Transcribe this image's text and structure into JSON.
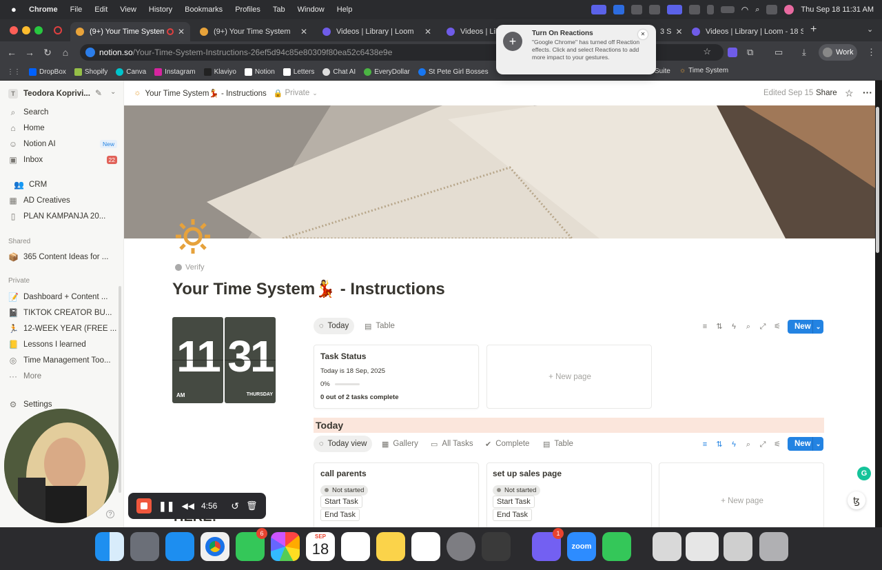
{
  "menubar": {
    "app": "Chrome",
    "items": [
      "File",
      "Edit",
      "View",
      "History",
      "Bookmarks",
      "Profiles",
      "Tab",
      "Window",
      "Help"
    ],
    "clock": "Thu Sep 18  11:31 AM"
  },
  "tabs": [
    {
      "label": "(9+) Your Time System - I",
      "active": true
    },
    {
      "label": "(9+) Your Time System"
    },
    {
      "label": "Videos | Library | Loom"
    },
    {
      "label": "Videos | Librar"
    },
    {
      "label": "Videos | Library | Loom - 18 S"
    }
  ],
  "tab_partial": "3 S",
  "address": {
    "host": "notion.so",
    "path": "/Your-Time-System-Instructions-26ef5d94c85e80309f80ea52c6438e9e"
  },
  "profile": "Work",
  "bookmarks": [
    "DropBox",
    "Shopify",
    "Canva",
    "Instagram",
    "Klaviyo",
    "Notion",
    "Letters",
    "Chat AI",
    "EveryDollar",
    "St Pete Girl Bosses",
    "Suite",
    "Time System"
  ],
  "notification": {
    "title": "Turn On Reactions",
    "body": "\"Google Chrome\" has turned off Reaction effects. Click  and select Reactions to add more impact to your gestures."
  },
  "sidebar": {
    "workspace": "Teodora Koprivi...",
    "top": [
      {
        "label": "Search",
        "icon": "search-icon"
      },
      {
        "label": "Home",
        "icon": "home-icon"
      },
      {
        "label": "Notion AI",
        "icon": "ai-icon",
        "tag": "New"
      },
      {
        "label": "Inbox",
        "icon": "inbox-icon",
        "count": "22"
      }
    ],
    "teamspace": [
      {
        "label": "CRM"
      },
      {
        "label": "AD Creatives"
      },
      {
        "label": "PLAN KAMPANJA 20..."
      }
    ],
    "shared_label": "Shared",
    "shared": [
      {
        "label": "365 Content Ideas for ..."
      }
    ],
    "private_label": "Private",
    "private": [
      {
        "label": "Dashboard + Content ..."
      },
      {
        "label": "TIKTOK CREATOR BU..."
      },
      {
        "label": "12-WEEK YEAR (FREE ..."
      },
      {
        "label": "Lessons I learned"
      },
      {
        "label": "Time Management Too..."
      }
    ],
    "more": "More",
    "settings": "Settings"
  },
  "page": {
    "breadcrumb": "Your Time System💃 - Instructions",
    "privacy": "Private",
    "edited": "Edited Sep 15",
    "share": "Share",
    "verify": "Verify",
    "title": "Your Time System💃 - Instructions",
    "clock": {
      "hour": "11",
      "minute": "31",
      "ampm": "AM",
      "day": "THURSDAY"
    },
    "views1": [
      {
        "label": "Today",
        "selected": true
      },
      {
        "label": "Table"
      }
    ],
    "new_button": "New",
    "task_status": {
      "title": "Task Status",
      "date_line": "Today is 18 Sep, 2025",
      "progress_text": "0%",
      "progress": 0,
      "complete_line": "0 out of 2 tasks complete"
    },
    "new_page": "New page",
    "today_heading": "Today",
    "views2": [
      {
        "label": "Today view",
        "selected": true
      },
      {
        "label": "Gallery"
      },
      {
        "label": "All Tasks"
      },
      {
        "label": "Complete"
      },
      {
        "label": "Table"
      }
    ],
    "cards": [
      {
        "title": "call parents",
        "status": "Not started",
        "start": "Start Task",
        "end": "End Task"
      },
      {
        "title": "set up sales page",
        "status": "Not started",
        "start": "Start Task",
        "end": "End Task"
      }
    ],
    "bottom_partial": "HERE!"
  },
  "loom": {
    "time": "4:56"
  },
  "dock": {
    "calendar_month": "SEP",
    "calendar_day": "18",
    "messages_badge": "6",
    "viber_badge": "1",
    "zoom_label": "zoom"
  }
}
